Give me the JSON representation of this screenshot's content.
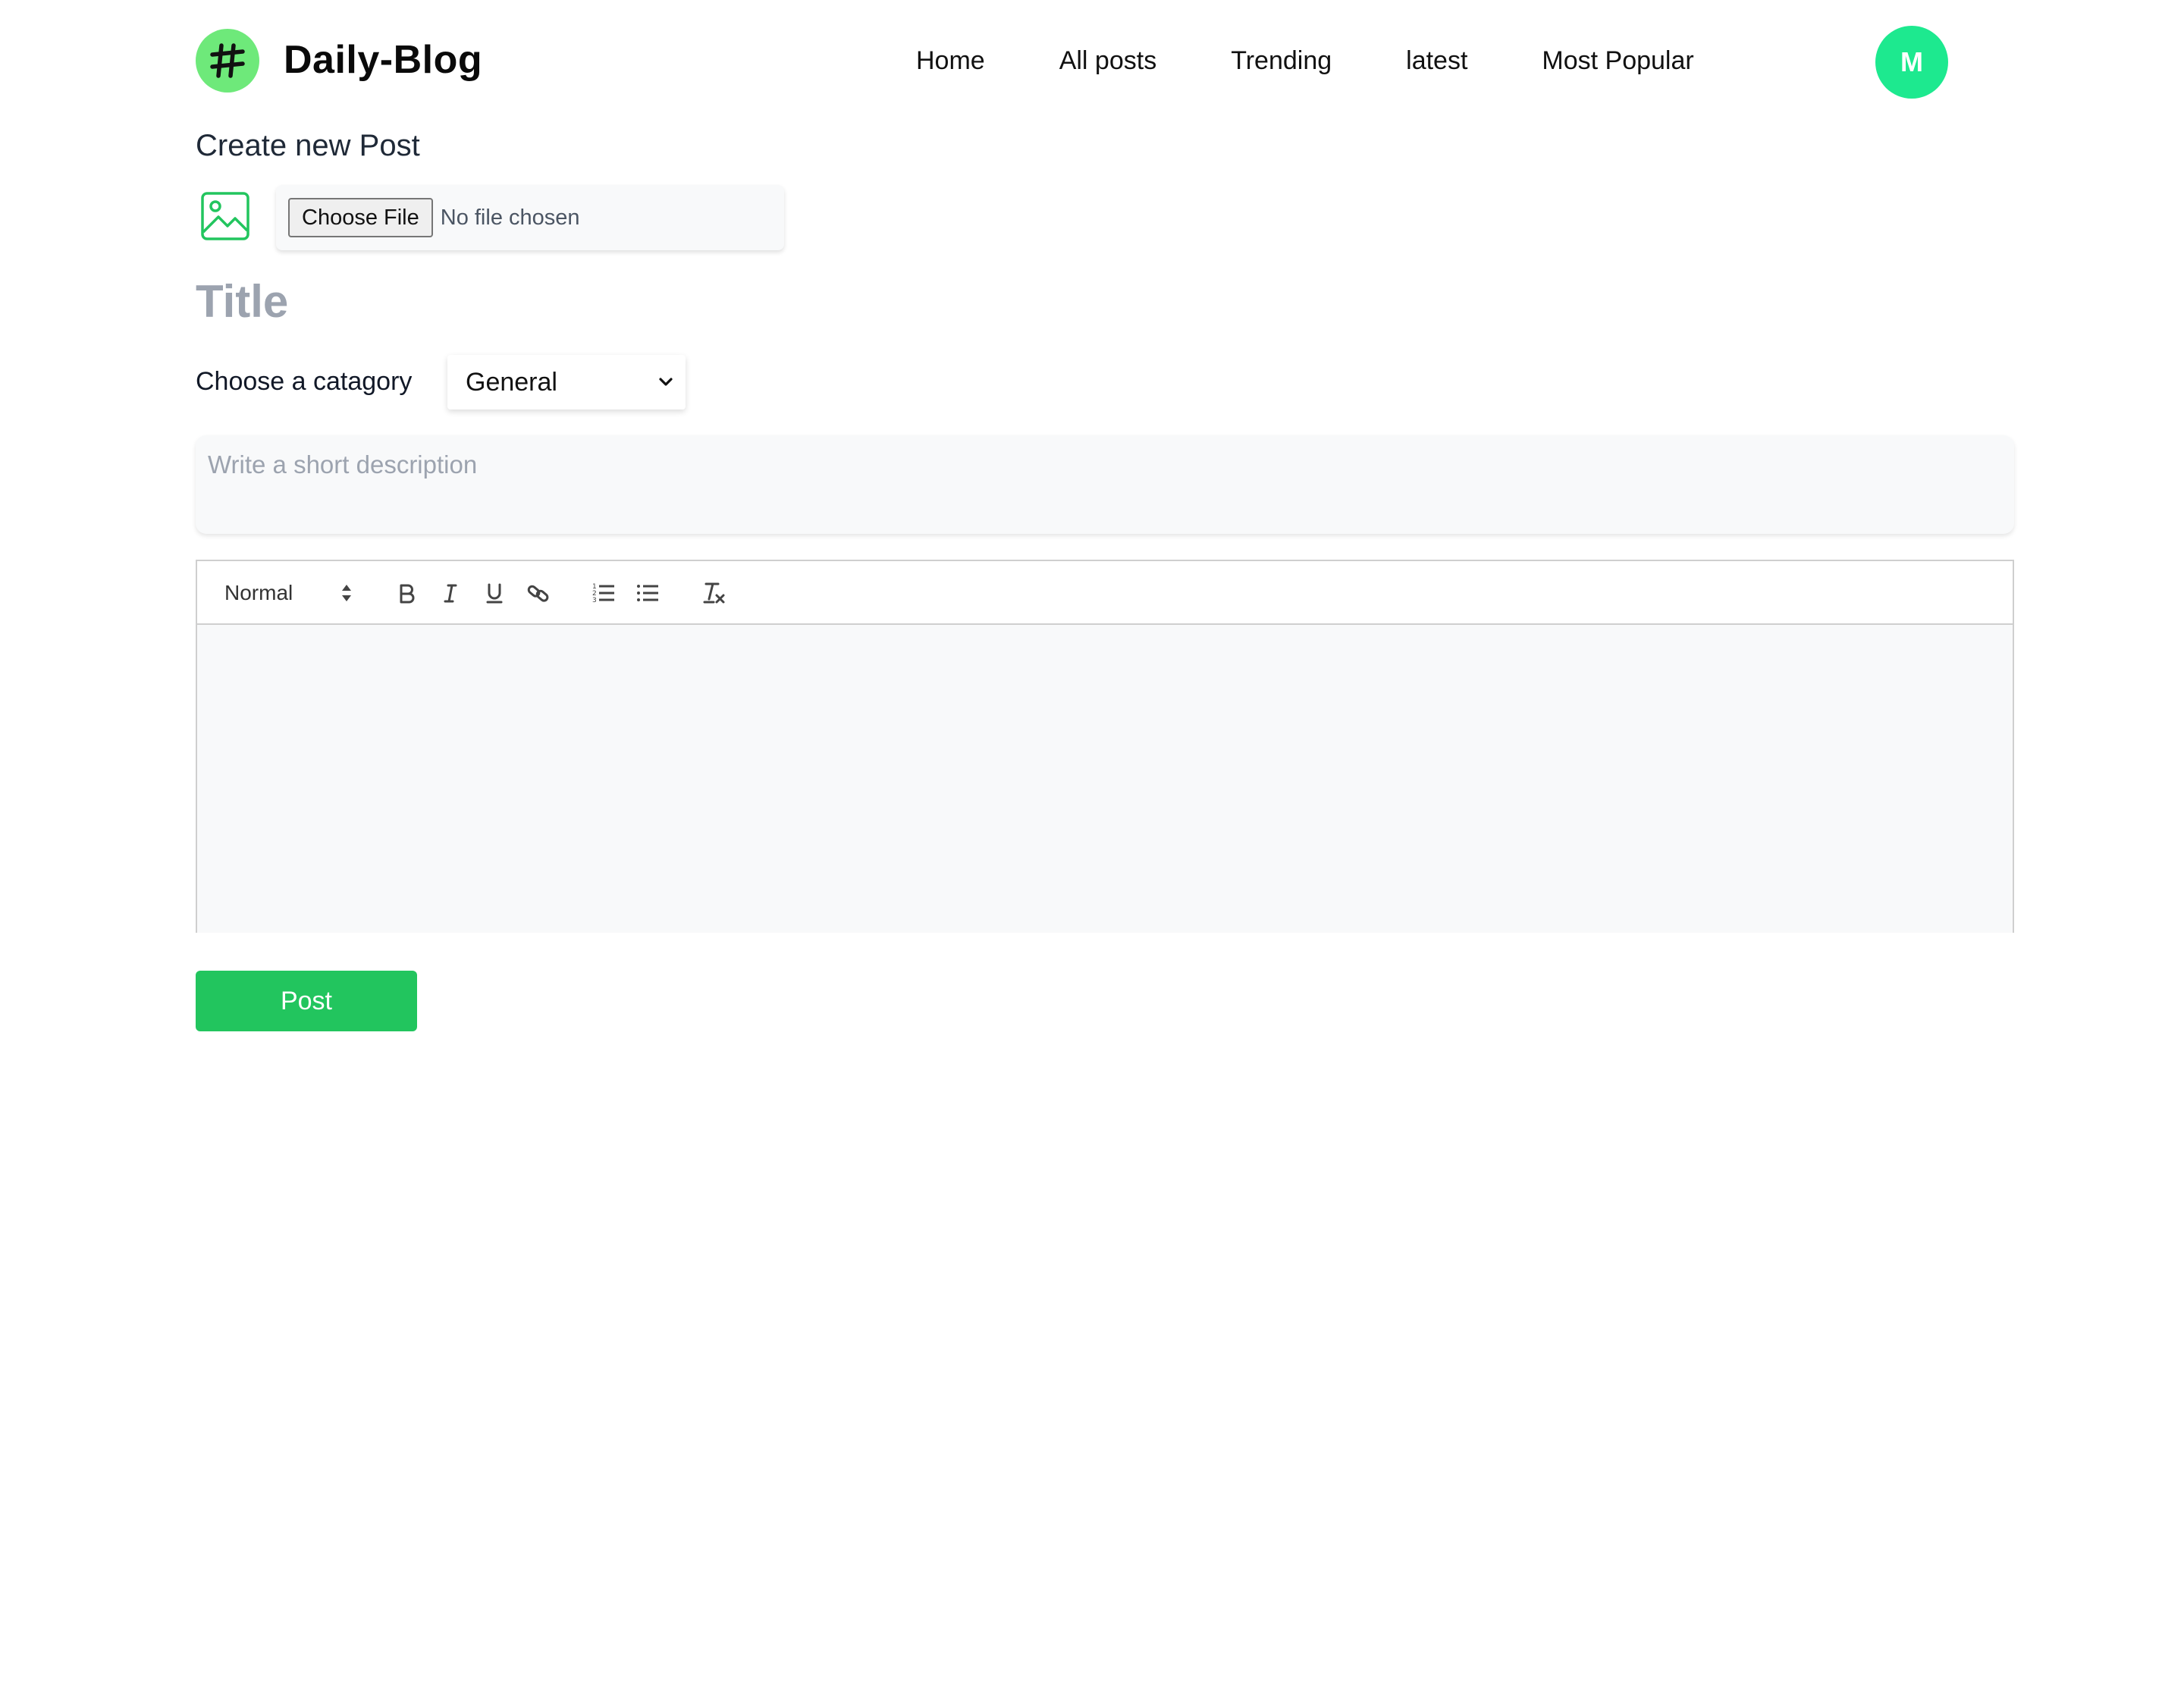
{
  "header": {
    "brand": "Daily-Blog",
    "nav": [
      "Home",
      "All posts",
      "Trending",
      "latest",
      "Most Popular"
    ],
    "avatar_initial": "M"
  },
  "form": {
    "heading": "Create new Post",
    "file": {
      "button_label": "Choose File",
      "status": "No file chosen"
    },
    "title_placeholder": "Title",
    "category": {
      "label": "Choose a catagory",
      "selected": "General"
    },
    "description_placeholder": "Write a short description",
    "editor": {
      "size_label": "Normal",
      "tools": [
        "bold-icon",
        "italic-icon",
        "underline-icon",
        "link-icon",
        "ordered-list-icon",
        "bullet-list-icon",
        "clear-format-icon"
      ]
    },
    "submit_label": "Post"
  },
  "colors": {
    "accent": "#22c55e",
    "avatar": "#1de98f",
    "logo": "#6ee97a",
    "icon_green": "#22c55e"
  }
}
